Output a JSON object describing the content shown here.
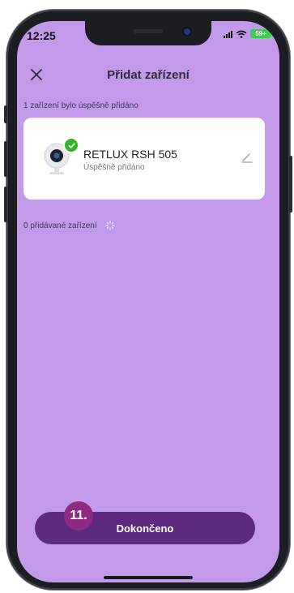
{
  "status_bar": {
    "time": "12:25",
    "battery": "59+"
  },
  "header": {
    "title": "Přidat zařízení"
  },
  "success_section": {
    "label": "1 zařízení bylo úspěšně přidáno"
  },
  "device": {
    "name": "RETLUX RSH 505",
    "status": "Úspěšně přidáno"
  },
  "adding_section": {
    "label": "0 přidávané zařízení"
  },
  "done_button": {
    "label": "Dokončeno"
  },
  "step_badge": {
    "label": "11."
  },
  "colors": {
    "background": "#c39ae9",
    "card": "#ffffff",
    "primary_button": "#5e2a7f",
    "step_badge": "#8f2a83",
    "success_check": "#35b22a"
  },
  "icons": {
    "close": "close-icon",
    "device": "camera-icon",
    "check": "check-icon",
    "edit": "edit-icon",
    "loading": "spinner-icon",
    "signal": "signal-icon",
    "wifi": "wifi-icon",
    "battery": "battery-icon"
  }
}
